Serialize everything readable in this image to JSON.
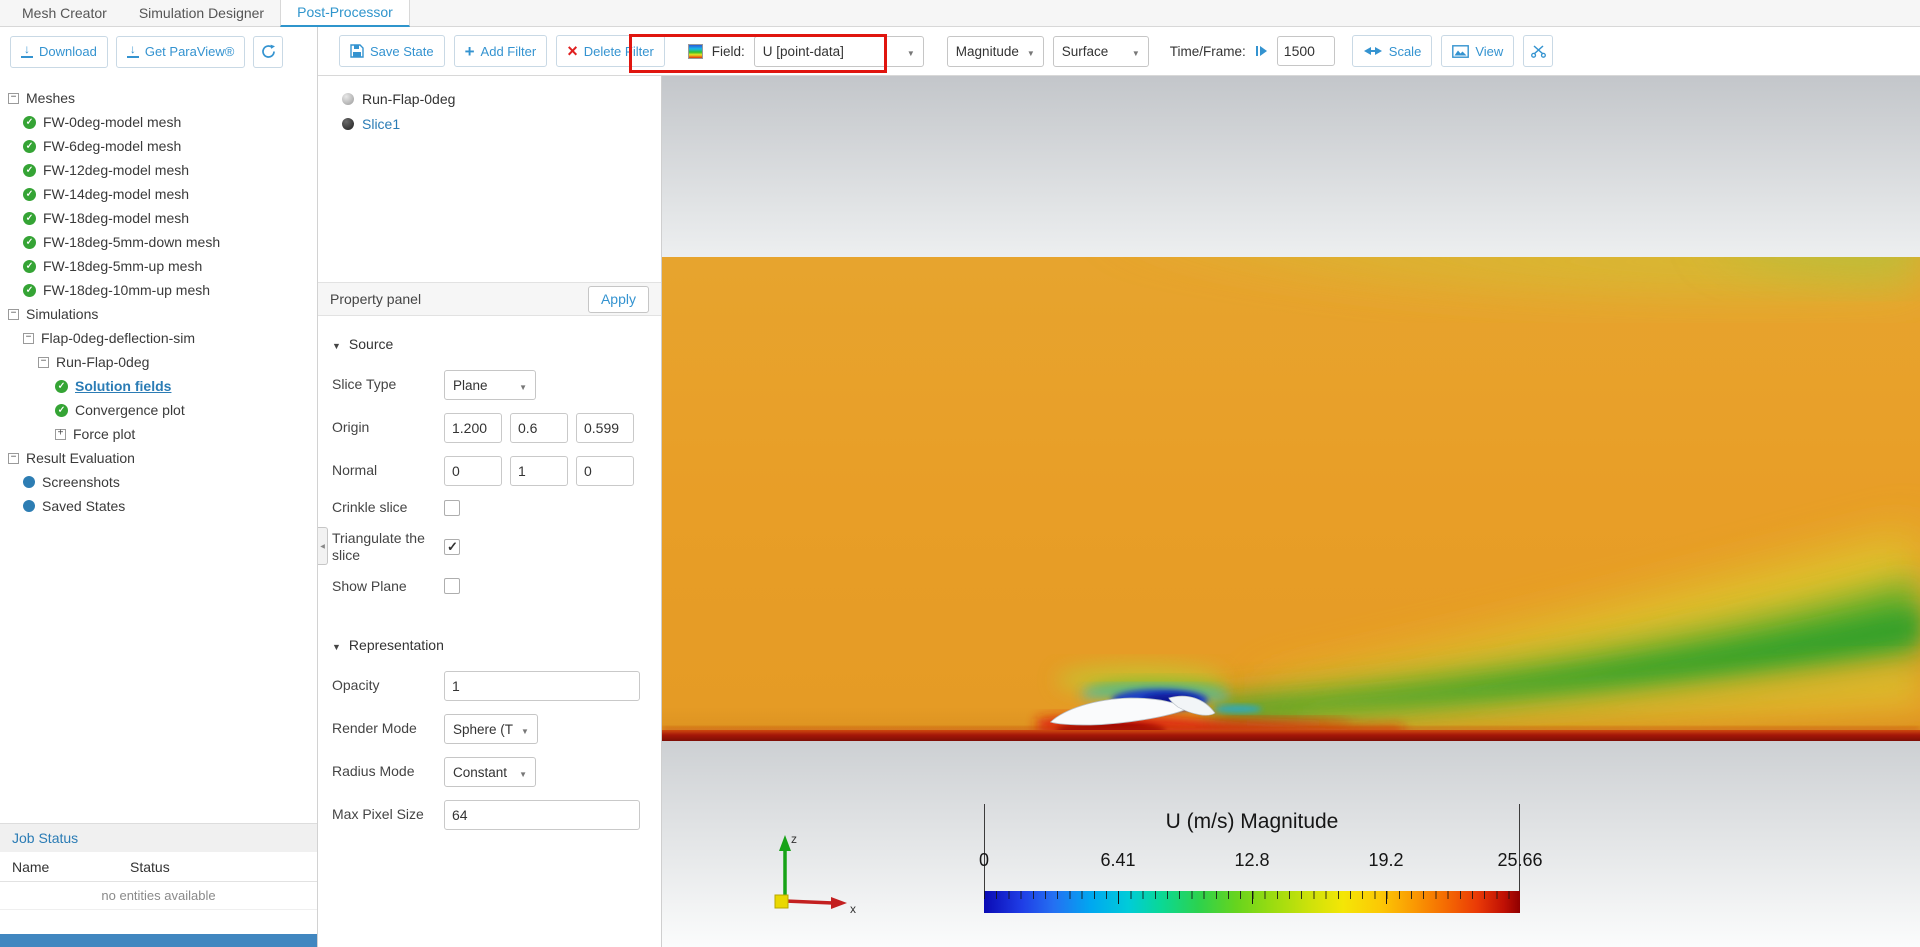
{
  "tabs": [
    {
      "label": "Mesh Creator"
    },
    {
      "label": "Simulation Designer"
    },
    {
      "label": "Post-Processor"
    }
  ],
  "sidebar": {
    "buttons": {
      "download": "Download",
      "paraview": "Get ParaView®"
    },
    "tree": {
      "items": [
        {
          "label": "Meshes"
        },
        {
          "label": "FW-0deg-model mesh"
        },
        {
          "label": "FW-6deg-model mesh"
        },
        {
          "label": "FW-12deg-model mesh"
        },
        {
          "label": "FW-14deg-model mesh"
        },
        {
          "label": "FW-18deg-model mesh"
        },
        {
          "label": "FW-18deg-5mm-down mesh"
        },
        {
          "label": "FW-18deg-5mm-up mesh"
        },
        {
          "label": "FW-18deg-10mm-up mesh"
        },
        {
          "label": "Simulations"
        },
        {
          "label": "Flap-0deg-deflection-sim"
        },
        {
          "label": "Run-Flap-0deg"
        },
        {
          "label": "Solution fields"
        },
        {
          "label": "Convergence plot"
        },
        {
          "label": "Force plot"
        },
        {
          "label": "Result Evaluation"
        },
        {
          "label": "Screenshots"
        },
        {
          "label": "Saved States"
        }
      ]
    },
    "job_status": {
      "title": "Job Status",
      "name_col": "Name",
      "status_col": "Status",
      "empty": "no entities available"
    }
  },
  "toolbar": {
    "save_state": "Save State",
    "add_filter": "Add Filter",
    "delete_filter": "Delete Filter",
    "field_label": "Field:",
    "field_value": "U [point-data]",
    "component_value": "Magnitude",
    "representation_value": "Surface",
    "time_label": "Time/Frame:",
    "time_value": "1500",
    "scale_label": "Scale",
    "view_label": "View"
  },
  "filter_tree": {
    "items": [
      {
        "label": "Run-Flap-0deg"
      },
      {
        "label": "Slice1"
      }
    ]
  },
  "property_panel": {
    "title": "Property panel",
    "apply_label": "Apply",
    "source": {
      "title": "Source",
      "slice_type_label": "Slice Type",
      "slice_type_value": "Plane",
      "origin_label": "Origin",
      "origin_x": "1.200",
      "origin_y": "0.6",
      "origin_z": "0.599",
      "normal_label": "Normal",
      "normal_x": "0",
      "normal_y": "1",
      "normal_z": "0",
      "crinkle_label": "Crinkle slice",
      "crinkle_checked": false,
      "triangulate_label": "Triangulate the slice",
      "triangulate_checked": true,
      "show_plane_label": "Show Plane",
      "show_plane_checked": false
    },
    "representation": {
      "title": "Representation",
      "opacity_label": "Opacity",
      "opacity_value": "1",
      "render_mode_label": "Render Mode",
      "render_mode_value": "Sphere (T",
      "radius_mode_label": "Radius Mode",
      "radius_mode_value": "Constant",
      "max_pixel_label": "Max Pixel Size",
      "max_pixel_value": "64"
    }
  },
  "viewport": {
    "legend": {
      "title": "U (m/s) Magnitude",
      "ticks": [
        "0",
        "6.41",
        "12.8",
        "19.2",
        "25.66"
      ]
    },
    "triad": {
      "z": "z",
      "x": "x"
    }
  },
  "colors": {
    "accent_blue": "#3493d0",
    "selection_blue": "#2b7cb5",
    "annotation_red": "#e0150f",
    "check_green": "#35a435"
  }
}
